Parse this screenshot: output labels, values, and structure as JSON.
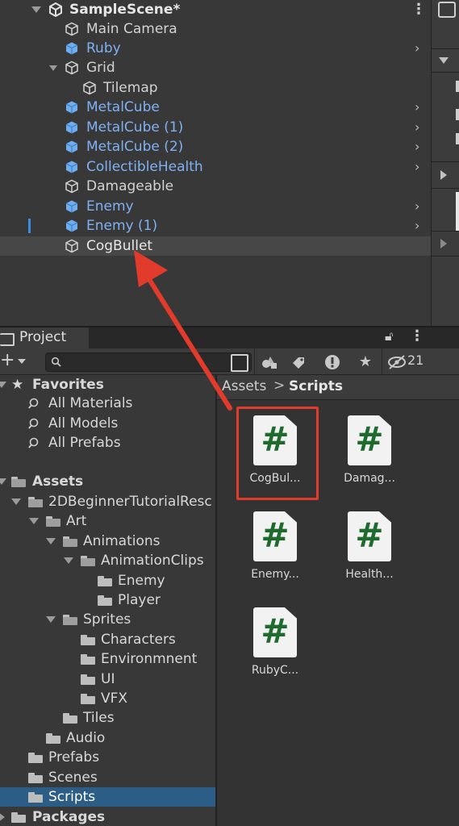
{
  "hierarchy": {
    "scene_name": "SampleScene*",
    "items": [
      {
        "label": "Main Camera",
        "prefab": false,
        "child": false
      },
      {
        "label": "Ruby",
        "prefab": true
      },
      {
        "label": "Grid",
        "prefab": false
      },
      {
        "label": "Tilemap",
        "prefab": false
      },
      {
        "label": "MetalCube",
        "prefab": true
      },
      {
        "label": "MetalCube (1)",
        "prefab": true
      },
      {
        "label": "MetalCube (2)",
        "prefab": true
      },
      {
        "label": "CollectibleHealth",
        "prefab": true
      },
      {
        "label": "Damageable",
        "prefab": false
      },
      {
        "label": "Enemy",
        "prefab": true
      },
      {
        "label": "Enemy (1)",
        "prefab": true
      },
      {
        "label": "CogBullet",
        "prefab": false
      }
    ]
  },
  "project": {
    "tab_label": "Project",
    "hidden_count": "21",
    "breadcrumb": {
      "root": "Assets",
      "sep": ">",
      "current": "Scripts"
    },
    "favorites": {
      "label": "Favorites",
      "items": [
        "All Materials",
        "All Models",
        "All Prefabs"
      ]
    },
    "tree": {
      "assets": "Assets",
      "res": "2DBeginnerTutorialResc",
      "art": "Art",
      "animations": "Animations",
      "animclips": "AnimationClips",
      "enemy": "Enemy",
      "player": "Player",
      "sprites": "Sprites",
      "characters": "Characters",
      "environment": "Environmnent",
      "ui": "UI",
      "vfx": "VFX",
      "tiles": "Tiles",
      "audio": "Audio",
      "prefabs": "Prefabs",
      "scenes": "Scenes",
      "scripts": "Scripts",
      "packages": "Packages"
    },
    "assets": [
      {
        "label": "CogBul...",
        "glyph": "#"
      },
      {
        "label": "Damag...",
        "glyph": "#"
      },
      {
        "label": "Enemy...",
        "glyph": "#"
      },
      {
        "label": "Health...",
        "glyph": "#"
      },
      {
        "label": "RubyC...",
        "glyph": "#"
      }
    ]
  },
  "colors": {
    "prefab_blue": "#7fb1f2",
    "selection": "#2c5d87",
    "annotation_red": "#e23a2b",
    "script_green": "#1f6b2e"
  }
}
